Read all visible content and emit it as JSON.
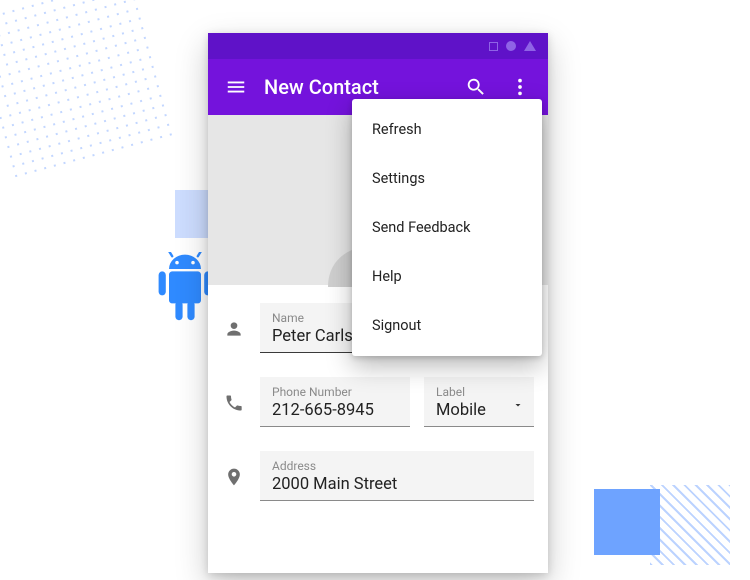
{
  "appbar": {
    "title": "New Contact"
  },
  "menu": {
    "items": [
      {
        "label": "Refresh"
      },
      {
        "label": "Settings"
      },
      {
        "label": "Send Feedback"
      },
      {
        "label": "Help"
      },
      {
        "label": "Signout"
      }
    ]
  },
  "form": {
    "name": {
      "label": "Name",
      "value": "Peter Carlsson"
    },
    "phone": {
      "label": "Phone Number",
      "value": "212-665-8945"
    },
    "ptype": {
      "label": "Label",
      "value": "Mobile"
    },
    "address": {
      "label": "Address",
      "value": "2000 Main Street"
    }
  },
  "colors": {
    "primary": "#7413dc",
    "primaryDark": "#5f12c8",
    "accent": "#2f8aff"
  }
}
